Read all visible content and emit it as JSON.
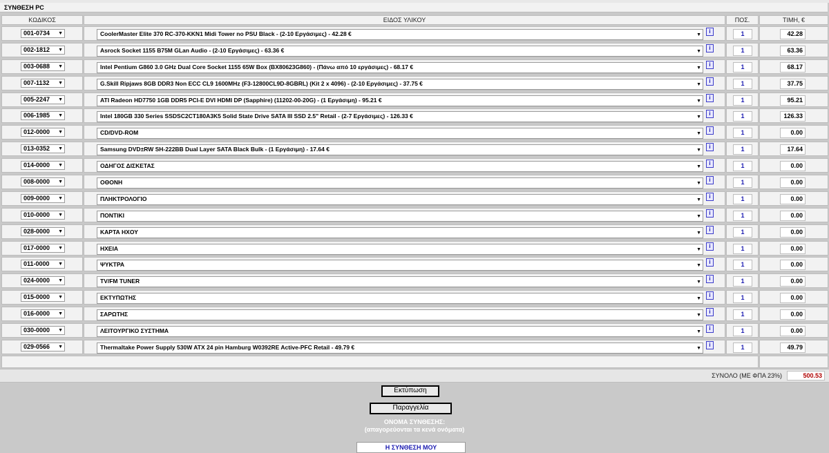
{
  "panel_title": "ΣΥΝΘΕΣΗ PC",
  "headers": {
    "code": "ΚΩΔΙΚΟΣ",
    "item": "ΕΙΔΟΣ ΥΛΙΚΟΥ",
    "qty": "ΠΟΣ.",
    "price": "ΤΙΜΗ, €"
  },
  "info_label": "i",
  "rows": [
    {
      "code": "001-0734",
      "item": "CoolerMaster Elite 370 RC-370-KKN1 Midi Tower no PSU Black - (2-10 Εργάσιμες) - 42.28 €",
      "qty": "1",
      "price": "42.28"
    },
    {
      "code": "002-1812",
      "item": "Asrock Socket 1155 B75M GLan Audio - (2-10 Εργάσιμες) - 63.36 €",
      "qty": "1",
      "price": "63.36"
    },
    {
      "code": "003-0688",
      "item": "Intel Pentium G860 3.0 GHz Dual Core Socket 1155 65W Box (BX80623G860) - (Πάνω από 10 εργάσιμες) - 68.17 €",
      "qty": "1",
      "price": "68.17"
    },
    {
      "code": "007-1132",
      "item": "G.Skill Ripjaws 8GB DDR3 Non ECC CL9 1600MHz (F3-12800CL9D-8GBRL) (Kit 2 x 4096) - (2-10 Εργάσιμες) - 37.75 €",
      "qty": "1",
      "price": "37.75"
    },
    {
      "code": "005-2247",
      "item": "ATI Radeon HD7750 1GB DDR5 PCI-E DVI HDMI DP (Sapphire) (11202-00-20G) - (1 Εργάσιμη) - 95.21 €",
      "qty": "1",
      "price": "95.21"
    },
    {
      "code": "006-1985",
      "item": "Intel 180GB 330 Series SSDSC2CT180A3K5 Solid State Drive SATA III SSD 2.5\" Retail - (2-7 Εργάσιμες) - 126.33 €",
      "qty": "1",
      "price": "126.33"
    },
    {
      "code": "012-0000",
      "item": "CD/DVD-ROM",
      "qty": "1",
      "price": "0.00"
    },
    {
      "code": "013-0352",
      "item": "Samsung DVD±RW SH-222BB Dual Layer SATA Black Bulk - (1 Εργάσιμη) - 17.64 €",
      "qty": "1",
      "price": "17.64"
    },
    {
      "code": "014-0000",
      "item": "ΟΔΗΓΟΣ ΔΙΣΚΕΤΑΣ",
      "qty": "1",
      "price": "0.00"
    },
    {
      "code": "008-0000",
      "item": "ΟΘΟΝΗ",
      "qty": "1",
      "price": "0.00"
    },
    {
      "code": "009-0000",
      "item": "ΠΛΗΚΤΡΟΛΟΓΙΟ",
      "qty": "1",
      "price": "0.00"
    },
    {
      "code": "010-0000",
      "item": "ΠΟΝΤΙΚΙ",
      "qty": "1",
      "price": "0.00"
    },
    {
      "code": "028-0000",
      "item": "ΚΑΡΤΑ ΗΧΟΥ",
      "qty": "1",
      "price": "0.00"
    },
    {
      "code": "017-0000",
      "item": "ΗΧΕΙΑ",
      "qty": "1",
      "price": "0.00"
    },
    {
      "code": "011-0000",
      "item": "ΨΥΚΤΡΑ",
      "qty": "1",
      "price": "0.00"
    },
    {
      "code": "024-0000",
      "item": "TV/FM TUNER",
      "qty": "1",
      "price": "0.00"
    },
    {
      "code": "015-0000",
      "item": "ΕΚΤΥΠΩΤΗΣ",
      "qty": "1",
      "price": "0.00"
    },
    {
      "code": "016-0000",
      "item": "ΣΑΡΩΤΗΣ",
      "qty": "1",
      "price": "0.00"
    },
    {
      "code": "030-0000",
      "item": "ΛΕΙΤΟΥΡΓΙΚΟ ΣΥΣΤΗΜΑ",
      "qty": "1",
      "price": "0.00"
    },
    {
      "code": "029-0566",
      "item": "Thermaltake Power Supply 530W ATX 24 pin Hamburg W0392RE Active-PFC Retail - 49.79 €",
      "qty": "1",
      "price": "49.79"
    }
  ],
  "total": {
    "label": "ΣΥΝΟΛΟ (ΜΕ ΦΠΑ 23%)",
    "value": "500.53"
  },
  "buttons": {
    "print": "Εκτύπωση",
    "order": "Παραγγελία"
  },
  "composition_name": {
    "label_line1": "ΟΝΟΜΑ ΣΥΝΘΕΣΗΣ:",
    "label_line2": "(απαγορεύονται τα κενά ονόματα)",
    "value": "Η ΣΥΝΘΕΣΗ ΜΟΥ"
  },
  "colors": {
    "total_value": "#b00000",
    "quantity_text": "#1a1ab0",
    "background": "#c9c9c9"
  }
}
